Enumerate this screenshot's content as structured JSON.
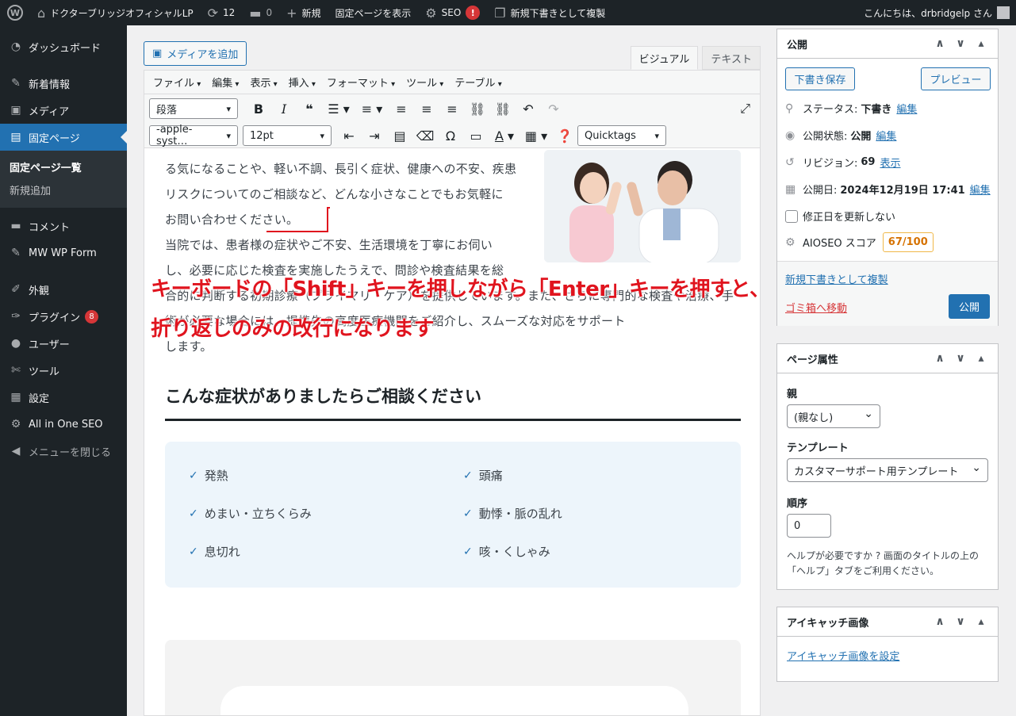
{
  "adminbar": {
    "site_name": "ドクターブリッジオフィシャルLP",
    "updates_count": "12",
    "comments_count": "0",
    "new_label": "新規",
    "view_page": "固定ページを表示",
    "seo_label": "SEO",
    "seo_badge": "!",
    "duplicate_draft": "新規下書きとして複製",
    "greeting": "こんにちは、drbridgelp さん"
  },
  "sidebar": {
    "items": [
      {
        "label": "ダッシュボード",
        "icon": "dashboard-icon"
      },
      {
        "label": "新着情報",
        "icon": "pin-icon"
      },
      {
        "label": "メディア",
        "icon": "media-icon"
      },
      {
        "label": "固定ページ",
        "icon": "page-icon",
        "current": true
      },
      {
        "label": "コメント",
        "icon": "comment-icon"
      },
      {
        "label": "MW WP Form",
        "icon": "pin-icon"
      },
      {
        "label": "外観",
        "icon": "brush-icon"
      },
      {
        "label": "プラグイン",
        "icon": "plugin-icon",
        "badge": "8"
      },
      {
        "label": "ユーザー",
        "icon": "user-icon"
      },
      {
        "label": "ツール",
        "icon": "wrench-icon"
      },
      {
        "label": "設定",
        "icon": "settings-icon"
      },
      {
        "label": "All in One SEO",
        "icon": "aioseo-icon"
      },
      {
        "label": "メニューを閉じる",
        "icon": "collapse-icon"
      }
    ],
    "submenu": [
      "固定ページ一覧",
      "新規追加"
    ]
  },
  "editor": {
    "add_media": "メディアを追加",
    "tabs": [
      "ビジュアル",
      "テキスト"
    ],
    "menubar": [
      "ファイル",
      "編集",
      "表示",
      "挿入",
      "フォーマット",
      "ツール",
      "テーブル"
    ],
    "format_select": "段落",
    "font_select": "-apple-syst…",
    "size_select": "12pt",
    "quicktags": "Quicktags"
  },
  "content": {
    "lines_top": [
      "る気になることや、軽い不調、長引く症状、健康への不安、疾患",
      "リスクについてのご相談など、どんな小さなことでもお気軽に",
      "お問い合わせください。",
      "当院では、患者様の症状やご不安、生活環境を丁寧にお伺い",
      "し、必要に応じた検査を実施したうえで、問診や検査結果を総",
      "合的に判断する初期診療（プライマリ・ケア）を提供しています。また、さらに専門的な検査や治療、手",
      "術が必要な場合には、提携先の高度医療機関をご紹介し、スムーズな対応をサポート",
      "します。"
    ],
    "heading": "こんな症状がありましたらご相談ください",
    "symptoms": [
      "発熱",
      "頭痛",
      "めまい・立ちくらみ",
      "動悸・脈の乱れ",
      "息切れ",
      "咳・くしゃみ"
    ]
  },
  "annotation": {
    "line1": "キーボードの「Shift」キーを押しながら「Enter」キーを押すと、",
    "line2": "折り返しのみの改行になります"
  },
  "publish": {
    "title": "公開",
    "save_draft": "下書き保存",
    "preview": "プレビュー",
    "status_label": "ステータス:",
    "status_value": "下書き",
    "visibility_label": "公開状態:",
    "visibility_value": "公開",
    "revisions_label": "リビジョン:",
    "revisions_value": "69",
    "revisions_link": "表示",
    "date_label": "公開日:",
    "date_value": "2024年12月19日 17:41",
    "edit_link": "編集",
    "update_date": "修正日を更新しない",
    "aioseo_label": "AIOSEO スコア",
    "aioseo_score": "67/100",
    "duplicate_link": "新規下書きとして複製",
    "trash": "ゴミ箱へ移動",
    "publish_button": "公開"
  },
  "page_attributes": {
    "title": "ページ属性",
    "parent_label": "親",
    "parent_value": "(親なし)",
    "template_label": "テンプレート",
    "template_value": "カスタマーサポート用テンプレート",
    "order_label": "順序",
    "order_value": "0",
    "help": "ヘルプが必要ですか ? 画面のタイトルの上の「ヘルプ」タブをご利用ください。"
  },
  "featured_image": {
    "title": "アイキャッチ画像",
    "set_link": "アイキャッチ画像を設定"
  }
}
